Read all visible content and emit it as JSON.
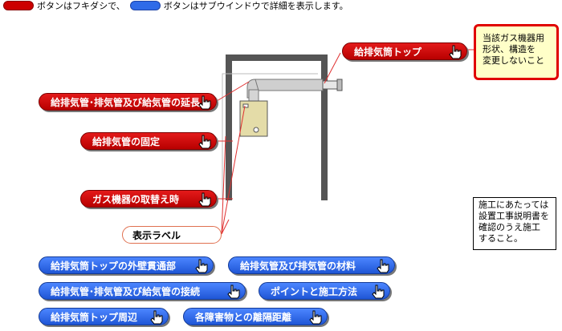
{
  "legend": {
    "red_text": "ボタンはフキダシで、",
    "blue_text": "ボタンはサブウインドウで詳細を表示します。",
    "red_color": "#cc0000",
    "blue_color": "#2f6be8"
  },
  "red_buttons": {
    "top": "給排気筒トップ",
    "extend": "給排気管･排気管及び給気管の延長",
    "fix": "給排気管の固定",
    "replace": "ガス機器の取替え時"
  },
  "label_button": "表示ラベル",
  "yellow_note": [
    "当該ガス機器用",
    "形状、構造を",
    "変更しないこと"
  ],
  "note": [
    "施工にあたっては",
    "設置工事説明書を",
    "確認のうえ施工",
    "すること。"
  ],
  "blue_buttons": {
    "wall": "給排気筒トップの外壁貫通部",
    "material": "給排気管及び排気管の材料",
    "connect": "給排気管･排気管及び給気管の接続",
    "points": "ポイントと施工方法",
    "around": "給排気筒トップ周辺",
    "distance": "各障害物との離隔距離"
  },
  "icons": {
    "pointer": "hand-pointer-icon"
  }
}
